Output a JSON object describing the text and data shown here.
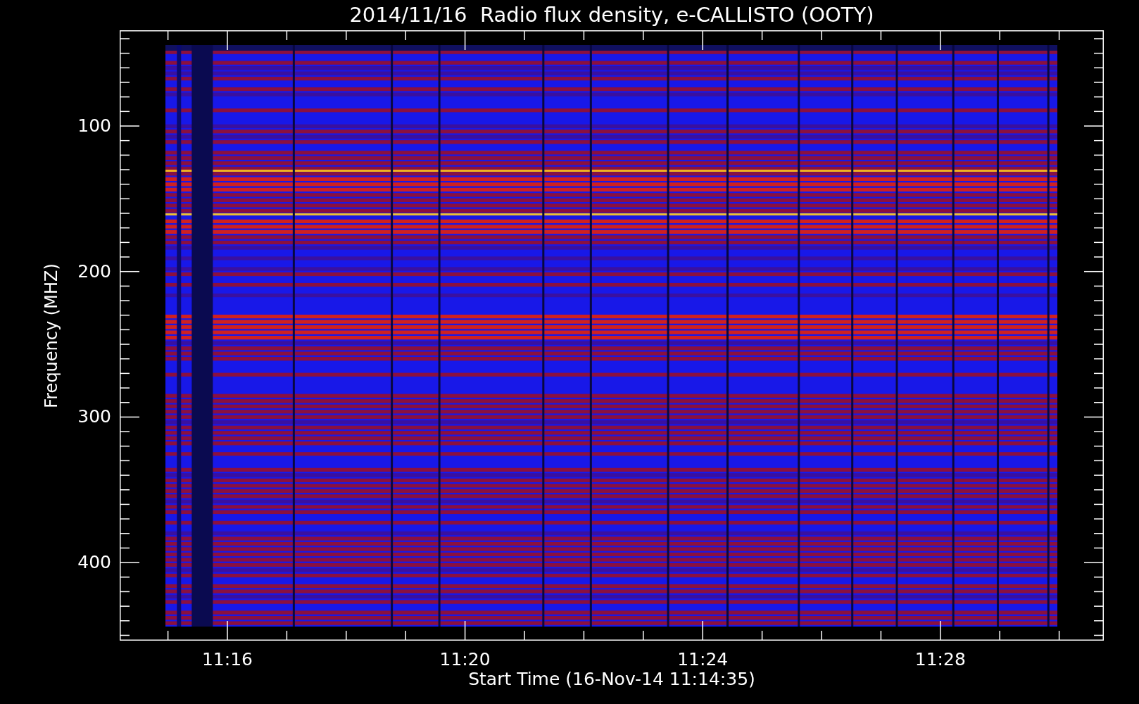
{
  "title": "2014/11/16  Radio flux density, e-CALLISTO (OOTY)",
  "y_axis": {
    "label": "Frequency (MHZ)",
    "ticks": [
      "100",
      "200",
      "300",
      "400"
    ]
  },
  "x_axis": {
    "label": "Start Time (16-Nov-14 11:14:35)",
    "ticks": [
      "11:16",
      "11:20",
      "11:24",
      "11:28"
    ]
  }
}
